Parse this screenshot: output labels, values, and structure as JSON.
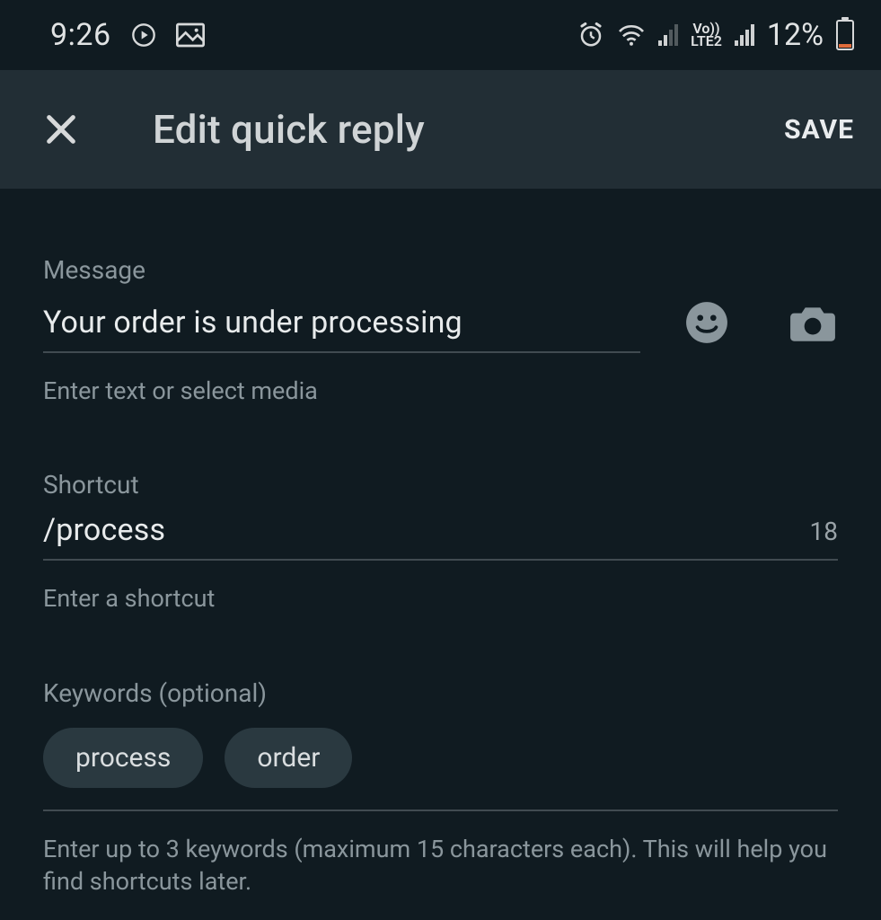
{
  "status": {
    "time": "9:26",
    "battery_pct": "12%",
    "network_label": "Vo))\nLTE2"
  },
  "appbar": {
    "title": "Edit quick reply",
    "save_label": "SAVE"
  },
  "message": {
    "label": "Message",
    "value": "Your order is under processing",
    "hint": "Enter text or select media"
  },
  "shortcut": {
    "label": "Shortcut",
    "value": "/process",
    "remaining": "18",
    "hint": "Enter a shortcut"
  },
  "keywords": {
    "label": "Keywords (optional)",
    "chips": [
      "process",
      "order"
    ],
    "hint": "Enter up to 3 keywords (maximum 15 characters each). This will help you find shortcuts later."
  }
}
